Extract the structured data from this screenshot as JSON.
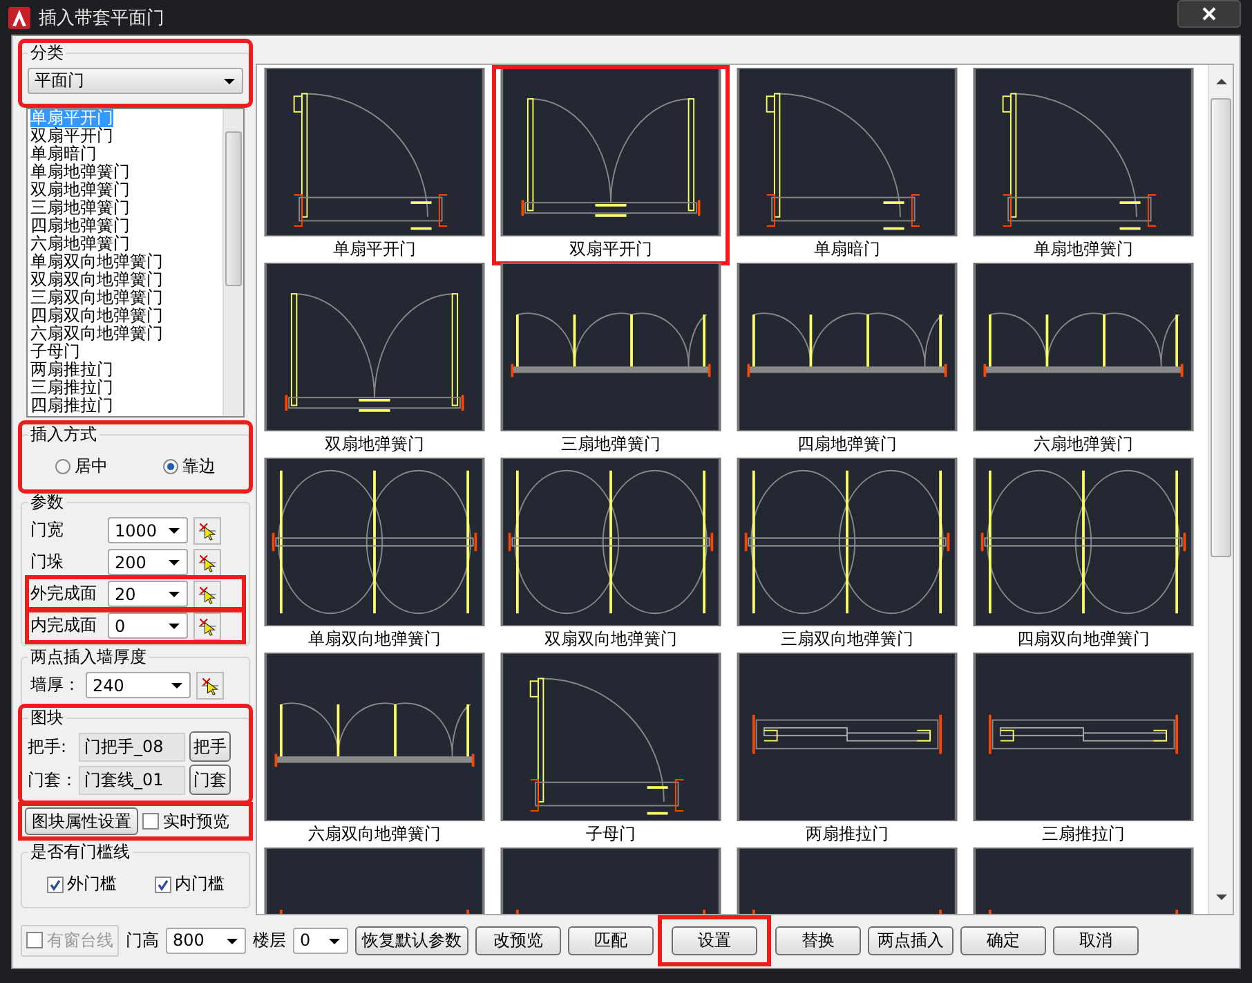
{
  "window": {
    "title": "插入带套平面门"
  },
  "category": {
    "title": "分类",
    "value": "平面门",
    "highlighted": true
  },
  "door_list": [
    {
      "label": "单扇平开门",
      "selected": true
    },
    {
      "label": "双扇平开门",
      "selected": false
    },
    {
      "label": "单扇暗门",
      "selected": false
    },
    {
      "label": "单扇地弹簧门",
      "selected": false
    },
    {
      "label": "双扇地弹簧门",
      "selected": false
    },
    {
      "label": "三扇地弹簧门",
      "selected": false
    },
    {
      "label": "四扇地弹簧门",
      "selected": false
    },
    {
      "label": "六扇地弹簧门",
      "selected": false
    },
    {
      "label": "单扇双向地弹簧门",
      "selected": false
    },
    {
      "label": "双扇双向地弹簧门",
      "selected": false
    },
    {
      "label": "三扇双向地弹簧门",
      "selected": false
    },
    {
      "label": "四扇双向地弹簧门",
      "selected": false
    },
    {
      "label": "六扇双向地弹簧门",
      "selected": false
    },
    {
      "label": "子母门",
      "selected": false
    },
    {
      "label": "两扇推拉门",
      "selected": false
    },
    {
      "label": "三扇推拉门",
      "selected": false
    },
    {
      "label": "四扇推拉门",
      "selected": false
    }
  ],
  "insert_mode": {
    "title": "插入方式",
    "highlighted": true,
    "options": [
      {
        "label": "居中",
        "selected": false
      },
      {
        "label": "靠边",
        "selected": true
      }
    ]
  },
  "params": {
    "title": "参数",
    "fields": [
      {
        "label": "门宽",
        "value": "1000",
        "highlighted": false
      },
      {
        "label": "门垛",
        "value": "200",
        "highlighted": false
      },
      {
        "label": "外完成面",
        "value": "20",
        "highlighted": true
      },
      {
        "label": "内完成面",
        "value": "0",
        "highlighted": true
      }
    ]
  },
  "wall": {
    "title": "两点插入墙厚度",
    "label": "墙厚：",
    "value": "240"
  },
  "block": {
    "title": "图块",
    "highlighted": true,
    "rows": [
      {
        "label": "把手:",
        "value": "门把手_08",
        "button": "把手"
      },
      {
        "label": "门套：",
        "value": "门套线_01",
        "button": "门套"
      }
    ]
  },
  "block_settings": {
    "button": "图块属性设置",
    "preview_label": "实时预览",
    "preview_checked": false,
    "highlighted": true
  },
  "threshold": {
    "title": "是否有门槛线",
    "options": [
      {
        "label": "外门槛",
        "checked": true
      },
      {
        "label": "内门槛",
        "checked": true
      }
    ]
  },
  "tiles": [
    {
      "label": "单扇平开门",
      "highlighted": false
    },
    {
      "label": "双扇平开门",
      "highlighted": true
    },
    {
      "label": "单扇暗门",
      "highlighted": false
    },
    {
      "label": "单扇地弹簧门",
      "highlighted": false
    },
    {
      "label": "双扇地弹簧门",
      "highlighted": false
    },
    {
      "label": "三扇地弹簧门",
      "highlighted": false
    },
    {
      "label": "四扇地弹簧门",
      "highlighted": false
    },
    {
      "label": "六扇地弹簧门",
      "highlighted": false
    },
    {
      "label": "单扇双向地弹簧门",
      "highlighted": false
    },
    {
      "label": "双扇双向地弹簧门",
      "highlighted": false
    },
    {
      "label": "三扇双向地弹簧门",
      "highlighted": false
    },
    {
      "label": "四扇双向地弹簧门",
      "highlighted": false
    },
    {
      "label": "六扇双向地弹簧门",
      "highlighted": false
    },
    {
      "label": "子母门",
      "highlighted": false
    },
    {
      "label": "两扇推拉门",
      "highlighted": false
    },
    {
      "label": "三扇推拉门",
      "highlighted": false
    },
    {
      "highlighted": false
    },
    {
      "highlighted": false
    },
    {
      "highlighted": false
    },
    {
      "highlighted": false
    }
  ],
  "bottom": {
    "sill": {
      "label": "有窗台线",
      "checked": false,
      "disabled": true
    },
    "height": {
      "label": "门高",
      "value": "800"
    },
    "floor": {
      "label": "楼层",
      "value": "0"
    },
    "buttons": [
      {
        "label": "恢复默认参数",
        "highlighted": false
      },
      {
        "label": "改预览",
        "highlighted": false
      },
      {
        "label": "匹配",
        "highlighted": false
      },
      {
        "label": "设置",
        "highlighted": true
      },
      {
        "label": "替换",
        "highlighted": false
      },
      {
        "label": "两点插入",
        "highlighted": false
      },
      {
        "label": "确定",
        "highlighted": false
      },
      {
        "label": "取消",
        "highlighted": false
      }
    ]
  }
}
